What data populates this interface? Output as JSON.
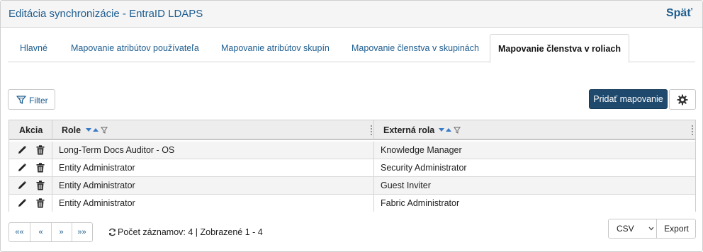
{
  "header": {
    "title": "Editácia synchronizácie - EntraID LDAPS",
    "back_label": "Späť"
  },
  "tabs": [
    {
      "label": "Hlavné"
    },
    {
      "label": "Mapovanie atribútov používateľa"
    },
    {
      "label": "Mapovanie atribútov skupín"
    },
    {
      "label": "Mapovanie členstva v skupinách"
    },
    {
      "label": "Mapovanie členstva v roliach"
    }
  ],
  "toolbar": {
    "filter_label": "Filter",
    "add_label": "Pridať mapovanie",
    "settings_icon": "gear-icon"
  },
  "table": {
    "columns": [
      "Akcia",
      "Role",
      "Externá rola"
    ],
    "rows": [
      {
        "role": "Long-Term Docs Auditor - OS",
        "external": "Knowledge Manager"
      },
      {
        "role": "Entity Administrator",
        "external": "Security Administrator"
      },
      {
        "role": "Entity Administrator",
        "external": "Guest Inviter"
      },
      {
        "role": "Entity Administrator",
        "external": "Fabric Administrator"
      }
    ]
  },
  "pager": {
    "first": "««",
    "prev": "«",
    "next": "»",
    "last": "»»"
  },
  "status": {
    "count_text": "Počet záznamov: 4 | Zobrazené 1 - 4"
  },
  "export": {
    "format": "CSV",
    "button_label": "Export"
  },
  "colors": {
    "accent": "#1e5d8f",
    "primary_button": "#1f4a6e"
  }
}
